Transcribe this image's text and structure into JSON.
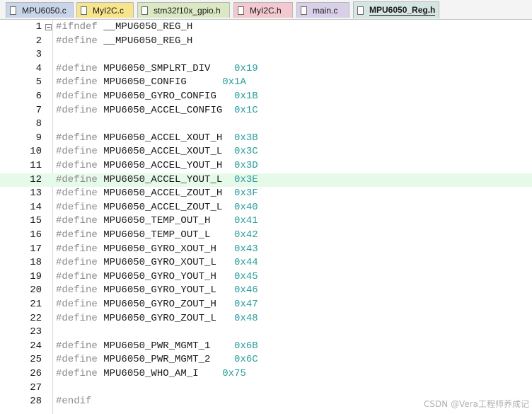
{
  "tabs": [
    {
      "label": "MPU6050.c",
      "color": "#c9d6ea",
      "active": false
    },
    {
      "label": "MyI2C.c",
      "color": "#f6e58b",
      "active": false
    },
    {
      "label": "stm32f10x_gpio.h",
      "color": "#dbe8c4",
      "active": false
    },
    {
      "label": "MyI2C.h",
      "color": "#f3c8cf",
      "active": false
    },
    {
      "label": "main.c",
      "color": "#d9cfe8",
      "active": false
    },
    {
      "label": "MPU6050_Reg.h",
      "color": "#d5e6e2",
      "active": true
    }
  ],
  "editor": {
    "highlight_line": 12,
    "highlight_color": "#e6faea",
    "lines": [
      {
        "n": "1",
        "kw": "#ifndef",
        "name": " __MPU6050_REG_H",
        "hex": ""
      },
      {
        "n": "2",
        "kw": "#define",
        "name": " __MPU6050_REG_H",
        "hex": ""
      },
      {
        "n": "3",
        "kw": "",
        "name": "",
        "hex": ""
      },
      {
        "n": "4",
        "kw": "#define",
        "name": " MPU6050_SMPLRT_DIV    ",
        "hex": "0x19"
      },
      {
        "n": "5",
        "kw": "#define",
        "name": " MPU6050_CONFIG      ",
        "hex": "0x1A"
      },
      {
        "n": "6",
        "kw": "#define",
        "name": " MPU6050_GYRO_CONFIG   ",
        "hex": "0x1B"
      },
      {
        "n": "7",
        "kw": "#define",
        "name": " MPU6050_ACCEL_CONFIG  ",
        "hex": "0x1C"
      },
      {
        "n": "8",
        "kw": "",
        "name": "",
        "hex": ""
      },
      {
        "n": "9",
        "kw": "#define",
        "name": " MPU6050_ACCEL_XOUT_H  ",
        "hex": "0x3B"
      },
      {
        "n": "10",
        "kw": "#define",
        "name": " MPU6050_ACCEL_XOUT_L  ",
        "hex": "0x3C"
      },
      {
        "n": "11",
        "kw": "#define",
        "name": " MPU6050_ACCEL_YOUT_H  ",
        "hex": "0x3D"
      },
      {
        "n": "12",
        "kw": "#define",
        "name": " MPU6050_ACCEL_YOUT_L  ",
        "hex": "0x3E"
      },
      {
        "n": "13",
        "kw": "#define",
        "name": " MPU6050_ACCEL_ZOUT_H  ",
        "hex": "0x3F"
      },
      {
        "n": "14",
        "kw": "#define",
        "name": " MPU6050_ACCEL_ZOUT_L  ",
        "hex": "0x40"
      },
      {
        "n": "15",
        "kw": "#define",
        "name": " MPU6050_TEMP_OUT_H    ",
        "hex": "0x41"
      },
      {
        "n": "16",
        "kw": "#define",
        "name": " MPU6050_TEMP_OUT_L    ",
        "hex": "0x42"
      },
      {
        "n": "17",
        "kw": "#define",
        "name": " MPU6050_GYRO_XOUT_H   ",
        "hex": "0x43"
      },
      {
        "n": "18",
        "kw": "#define",
        "name": " MPU6050_GYRO_XOUT_L   ",
        "hex": "0x44"
      },
      {
        "n": "19",
        "kw": "#define",
        "name": " MPU6050_GYRO_YOUT_H   ",
        "hex": "0x45"
      },
      {
        "n": "20",
        "kw": "#define",
        "name": " MPU6050_GYRO_YOUT_L   ",
        "hex": "0x46"
      },
      {
        "n": "21",
        "kw": "#define",
        "name": " MPU6050_GYRO_ZOUT_H   ",
        "hex": "0x47"
      },
      {
        "n": "22",
        "kw": "#define",
        "name": " MPU6050_GYRO_ZOUT_L   ",
        "hex": "0x48"
      },
      {
        "n": "23",
        "kw": "",
        "name": "",
        "hex": ""
      },
      {
        "n": "24",
        "kw": "#define",
        "name": " MPU6050_PWR_MGMT_1    ",
        "hex": "0x6B"
      },
      {
        "n": "25",
        "kw": "#define",
        "name": " MPU6050_PWR_MGMT_2    ",
        "hex": "0x6C"
      },
      {
        "n": "26",
        "kw": "#define",
        "name": " MPU6050_WHO_AM_I    ",
        "hex": "0x75"
      },
      {
        "n": "27",
        "kw": "",
        "name": "",
        "hex": ""
      },
      {
        "n": "28",
        "kw": "#endif",
        "name": "",
        "hex": ""
      }
    ]
  },
  "watermark": "CSDN @Vera工程师养成记"
}
